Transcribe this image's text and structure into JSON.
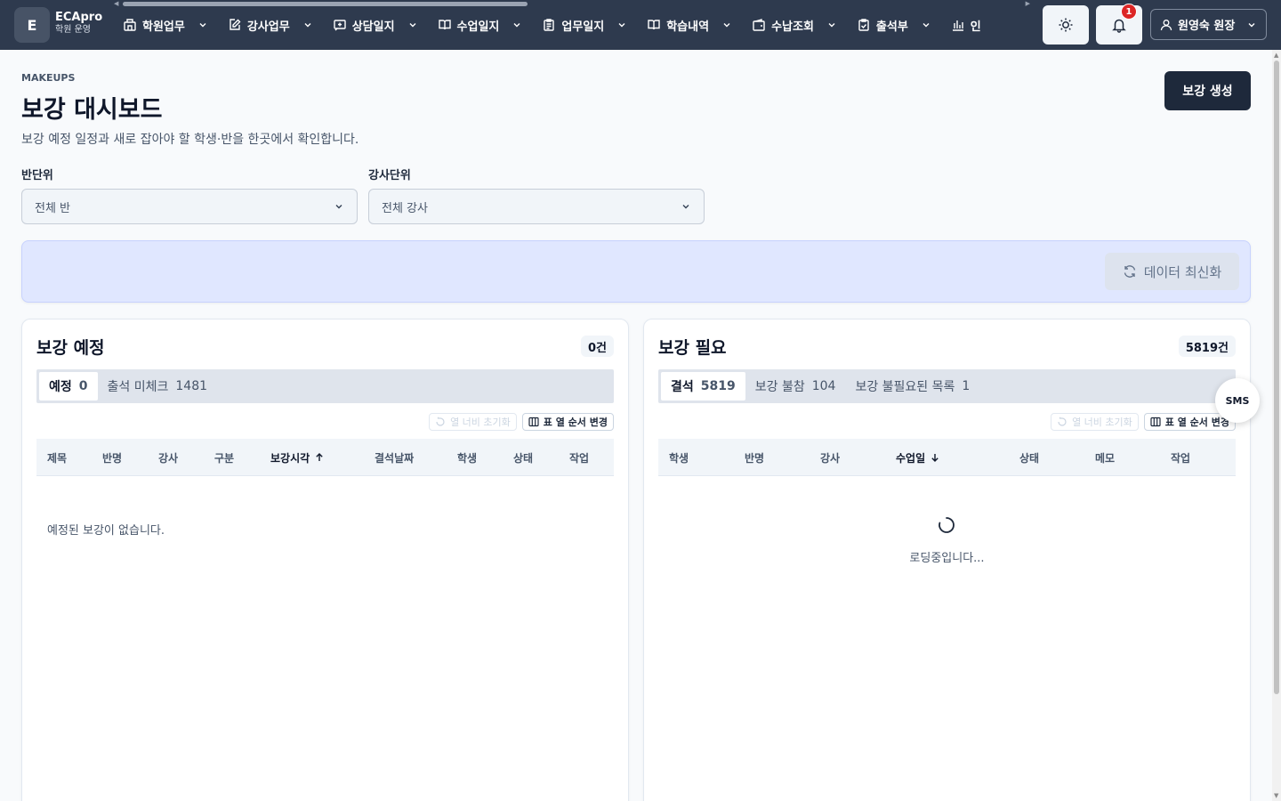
{
  "app": {
    "logo_letter": "E",
    "name": "ECApro",
    "subtitle": "학원 운영"
  },
  "nav": {
    "items": [
      {
        "label": "학원업무",
        "icon": "building-icon"
      },
      {
        "label": "강사업무",
        "icon": "edit-icon"
      },
      {
        "label": "상담일지",
        "icon": "message-plus-icon"
      },
      {
        "label": "수업일지",
        "icon": "book-open-icon"
      },
      {
        "label": "업무일지",
        "icon": "clipboard-list-icon"
      },
      {
        "label": "학습내역",
        "icon": "book-open-icon"
      },
      {
        "label": "수납조회",
        "icon": "wallet-icon"
      },
      {
        "label": "출석부",
        "icon": "clipboard-check-icon"
      },
      {
        "label": "인",
        "icon": "bar-chart-icon"
      }
    ],
    "notifications_count": "1",
    "user_label": "원영숙 원장"
  },
  "page": {
    "kicker": "MAKEUPS",
    "title": "보강 대시보드",
    "description": "보강 예정 일정과 새로 잡아야 할 학생·반을 한곳에서 확인합니다.",
    "create_button": "보강 생성"
  },
  "filters": {
    "class_label": "반단위",
    "class_value": "전체 반",
    "teacher_label": "강사단위",
    "teacher_value": "전체 강사"
  },
  "banner": {
    "refresh_label": "데이터 최신화"
  },
  "scheduled": {
    "title": "보강 예정",
    "count": "0건",
    "tabs": [
      {
        "label": "예정",
        "count": "0"
      },
      {
        "label": "출석 미체크",
        "count": "1481"
      }
    ],
    "reset_widths": "열 너비 초기화",
    "reorder_columns": "표 열 순서 변경",
    "columns": [
      "제목",
      "반명",
      "강사",
      "구분",
      "보강시각",
      "결석날짜",
      "학생",
      "상태",
      "작업"
    ],
    "sorted_column": "보강시각",
    "empty_message": "예정된 보강이 없습니다."
  },
  "needed": {
    "title": "보강 필요",
    "count": "5819건",
    "tabs": [
      {
        "label": "결석",
        "count": "5819"
      },
      {
        "label": "보강 불참",
        "count": "104"
      },
      {
        "label": "보강 불필요된 목록",
        "count": "1"
      }
    ],
    "reset_widths": "열 너비 초기화",
    "reorder_columns": "표 열 순서 변경",
    "columns": [
      "학생",
      "반명",
      "강사",
      "수업일",
      "상태",
      "메모",
      "작업"
    ],
    "sorted_column": "수업일",
    "loading_message": "로딩중입니다..."
  },
  "sms_button": "SMS"
}
